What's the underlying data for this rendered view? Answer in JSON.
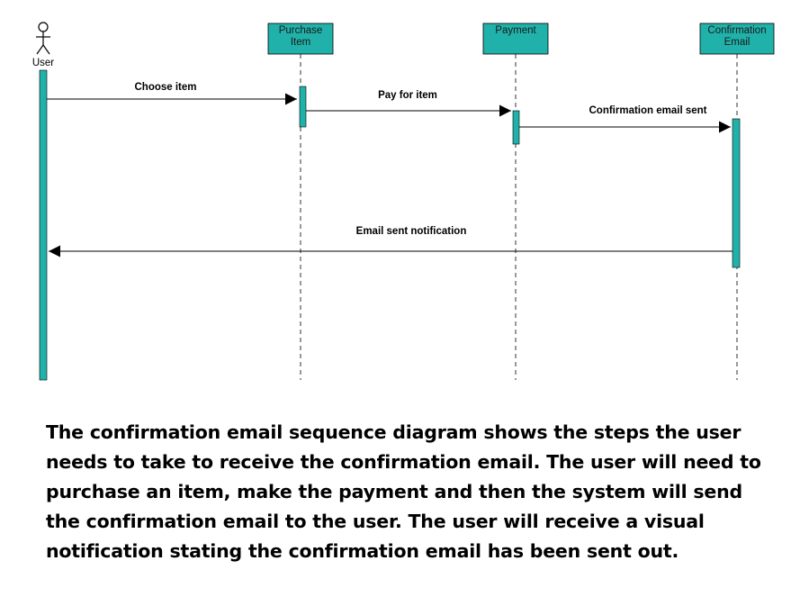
{
  "colors": {
    "box_fill": "#20b2aa",
    "stroke": "#000000"
  },
  "actor": {
    "label": "User",
    "icon": "stick-figure-icon"
  },
  "lifelines": [
    {
      "id": "purchase",
      "label_lines": [
        "Purchase",
        "Item"
      ]
    },
    {
      "id": "payment",
      "label_lines": [
        "Payment"
      ]
    },
    {
      "id": "confirmation",
      "label_lines": [
        "Confirmation",
        "Email"
      ]
    }
  ],
  "messages": [
    {
      "label": "Choose item",
      "from": "user",
      "to": "purchase"
    },
    {
      "label": "Pay for item",
      "from": "purchase",
      "to": "payment"
    },
    {
      "label": "Confirmation email sent",
      "from": "payment",
      "to": "confirmation"
    },
    {
      "label": "Email sent notification",
      "from": "confirmation",
      "to": "user"
    }
  ],
  "description": "The confirmation email sequence diagram shows the steps the user needs to take to receive the confirmation email. The user will need to purchase an item, make the payment and then the system will send the confirmation email to the user. The user will receive a visual notification stating the confirmation email has been sent out."
}
